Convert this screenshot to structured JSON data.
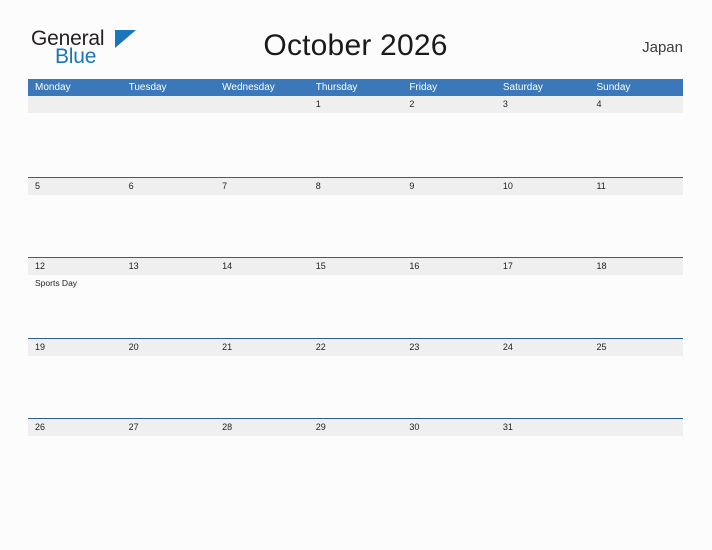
{
  "brand": {
    "name_part1": "General",
    "name_part2": "Blue",
    "mark": "triangle-flag-icon",
    "color_dark": "#231f20",
    "color_blue": "#1b75bb"
  },
  "header": {
    "title": "October 2026",
    "country": "Japan"
  },
  "theme": {
    "header_row_bg": "#3b78b9",
    "week_rule": "#2a6099",
    "date_band_bg": "#efefef",
    "page_bg": "#fcfcfc",
    "text": "#222222"
  },
  "calendar": {
    "day_headers": [
      "Monday",
      "Tuesday",
      "Wednesday",
      "Thursday",
      "Friday",
      "Saturday",
      "Sunday"
    ],
    "weeks": [
      {
        "dates": [
          "",
          "",
          "",
          "1",
          "2",
          "3",
          "4"
        ],
        "events": [
          [],
          [],
          [],
          [],
          [],
          [],
          []
        ]
      },
      {
        "dates": [
          "5",
          "6",
          "7",
          "8",
          "9",
          "10",
          "11"
        ],
        "events": [
          [],
          [],
          [],
          [],
          [],
          [],
          []
        ]
      },
      {
        "dates": [
          "12",
          "13",
          "14",
          "15",
          "16",
          "17",
          "18"
        ],
        "events": [
          [
            "Sports Day"
          ],
          [],
          [],
          [],
          [],
          [],
          []
        ]
      },
      {
        "dates": [
          "19",
          "20",
          "21",
          "22",
          "23",
          "24",
          "25"
        ],
        "events": [
          [],
          [],
          [],
          [],
          [],
          [],
          []
        ]
      },
      {
        "dates": [
          "26",
          "27",
          "28",
          "29",
          "30",
          "31",
          ""
        ],
        "events": [
          [],
          [],
          [],
          [],
          [],
          [],
          []
        ]
      }
    ]
  }
}
